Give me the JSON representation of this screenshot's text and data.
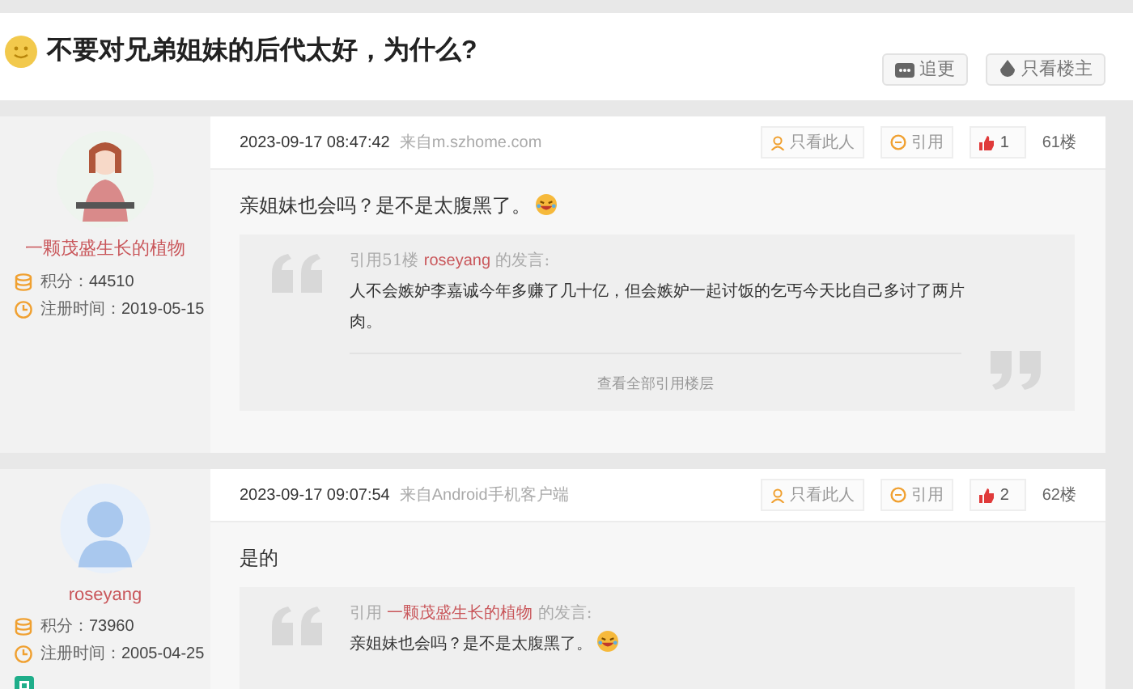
{
  "title": "不要对兄弟姐妹的后代太好，为什么?",
  "header_buttons": [
    {
      "label": "追更",
      "kind": "follow"
    },
    {
      "label": "只看楼主",
      "kind": "author"
    }
  ],
  "posts": [
    {
      "user": {
        "name": "一颗茂盛生长的植物",
        "kind": "illustration",
        "points_label": "积分：",
        "points": "44510",
        "reg_label": "注册时间：",
        "reg_date": "2019-05-15",
        "app_badge": false
      },
      "time": "2023-09-17 08:47:42",
      "source": "来自m.szhome.com",
      "actions": [
        "只看此人",
        "引用"
      ],
      "likes": "1",
      "floor": "61楼",
      "text": "亲姐妹也会吗？是不是太腹黑了。",
      "emoji": true,
      "quote": {
        "prefix": "引用51楼",
        "author": "roseyang",
        "suffix": "的发言:",
        "text": "人不会嫉妒李嘉诚今年多赚了几十亿，但会嫉妒一起讨饭的乞丐今天比自己多讨了两片肉。",
        "emoji": false,
        "more": "查看全部引用楼层"
      }
    },
    {
      "user": {
        "name": "roseyang",
        "kind": "silhouette",
        "points_label": "积分：",
        "points": "73960",
        "reg_label": "注册时间：",
        "reg_date": "2005-04-25",
        "app_badge": true
      },
      "time": "2023-09-17 09:07:54",
      "source": "来自Android手机客户端",
      "actions": [
        "只看此人",
        "引用"
      ],
      "likes": "2",
      "floor": "62楼",
      "text": "是的",
      "emoji": false,
      "quote": {
        "prefix": "引用",
        "author": "一颗茂盛生长的植物",
        "suffix": "的发言:",
        "text": "亲姐妹也会吗？是不是太腹黑了。",
        "emoji": true
      }
    }
  ]
}
